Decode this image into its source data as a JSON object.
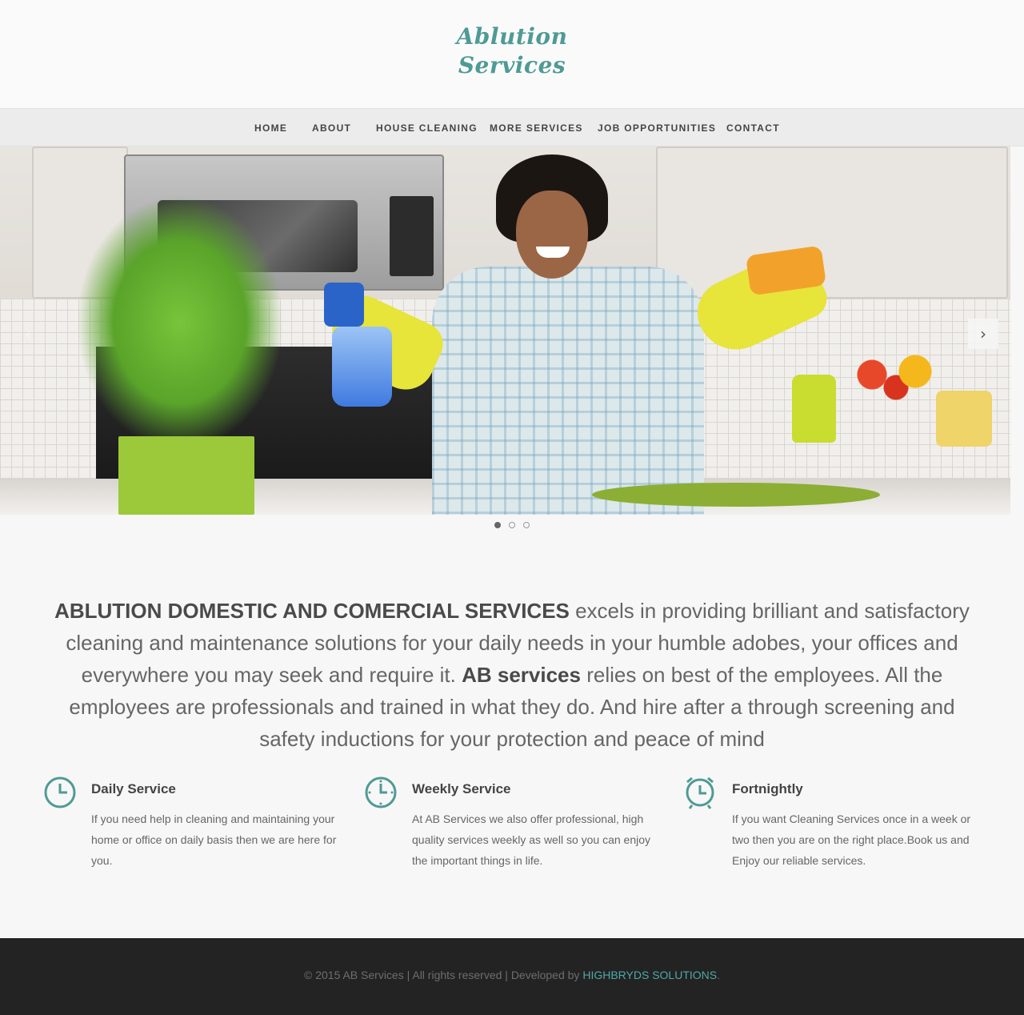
{
  "header": {
    "logo_line1": "Ablution",
    "logo_line2": "Services"
  },
  "nav": {
    "items": [
      "HOME",
      "ABOUT",
      "HOUSE CLEANING",
      "MORE SERVICES",
      "JOB OPPORTUNITIES",
      "CONTACT"
    ]
  },
  "slider": {
    "slide_count": 3,
    "active_slide": 1,
    "next_icon": "chevron-right-icon",
    "prev_icon": "chevron-left-icon"
  },
  "intro": {
    "company": "ABLUTION DOMESTIC AND COMERCIAL SERVICES",
    "text1": " excels in providing brilliant and satisfactory cleaning and maintenance solutions for your daily needs in your humble adobes, your offices and everywhere you may seek and require it. ",
    "brand": "AB services",
    "text2": " relies on best of the employees. All the employees are professionals and trained in what they do. And hire after a through screening and safety inductions for your protection and peace of mind"
  },
  "features": [
    {
      "icon": "clock-icon",
      "title": "Daily Service",
      "text": "If you need help in cleaning and maintaining your home or office on daily basis then we are here for you."
    },
    {
      "icon": "clock-dotted-icon",
      "title": "Weekly Service",
      "text": "At AB Services we also offer professional, high quality services weekly as well so you can enjoy the important things in life."
    },
    {
      "icon": "alarm-clock-icon",
      "title": "Fortnightly",
      "text": "If you want Cleaning Services once in a week or two then you are on the right place.Book us and Enjoy our reliable services."
    }
  ],
  "footer": {
    "text": "© 2015 AB Services | All rights reserved | Developed by ",
    "link": "HIGHBRYDS SOLUTIONS",
    "suffix": "."
  },
  "colors": {
    "accent": "#4f9a95",
    "footer_bg": "#232323",
    "link": "#4fa9a8"
  }
}
